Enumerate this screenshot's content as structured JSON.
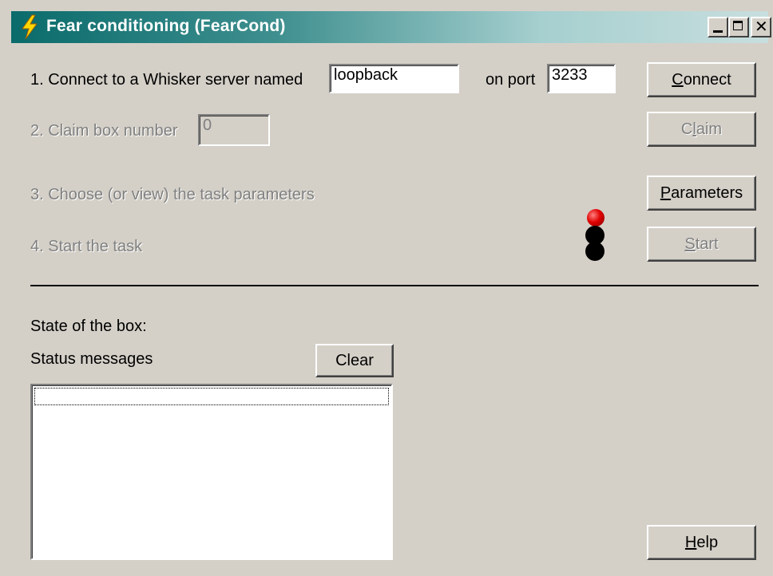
{
  "window": {
    "title": "Fear conditioning (FearCond)",
    "icon": "lightning-icon"
  },
  "step1": {
    "label": "1. Connect to a Whisker server named",
    "server_value": "loopback",
    "port_label": "on port",
    "port_value": "3233",
    "button_label_ul": "C",
    "button_label_rest": "onnect"
  },
  "step2": {
    "label": "2. Claim box number",
    "box_value": "0",
    "button_label_pre": "C",
    "button_label_ul": "l",
    "button_label_rest": "aim"
  },
  "step3": {
    "label": "3. Choose (or view) the task parameters",
    "button_label_ul": "P",
    "button_label_rest": "arameters"
  },
  "step4": {
    "label": "4. Start the task",
    "button_label_ul": "S",
    "button_label_rest": "tart"
  },
  "status": {
    "state_label": "State of the box:",
    "messages_label": "Status messages",
    "clear_label": "Clear"
  },
  "help": {
    "button_label_ul": "H",
    "button_label_rest": "elp"
  },
  "colors": {
    "title_gradient_start": "#0a6b6b",
    "title_gradient_end": "#c8dede",
    "face": "#d4d0c8",
    "disabled_text": "#808080",
    "light_red": "#e00000"
  }
}
